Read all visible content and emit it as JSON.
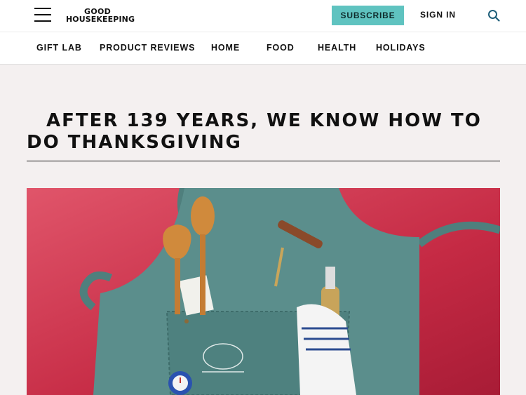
{
  "header": {
    "logo_line1": "GOOD",
    "logo_line2": "HOUSEKEEPING",
    "subscribe_label": "SUBSCRIBE",
    "signin_label": "SIGN IN",
    "menu_icon": "hamburger-menu-icon",
    "search_icon": "search-icon"
  },
  "nav": {
    "items": [
      "GIFT LAB",
      "PRODUCT REVIEWS",
      "HOME",
      "FOOD",
      "HEALTH",
      "HOLIDAYS"
    ]
  },
  "article": {
    "headline": "AFTER 139 YEARS, WE KNOW HOW TO DO THANKSGIVING"
  },
  "colors": {
    "accent": "#5fc3c0",
    "hero_background": "#c02a44",
    "apron": "#5b8e8c"
  }
}
